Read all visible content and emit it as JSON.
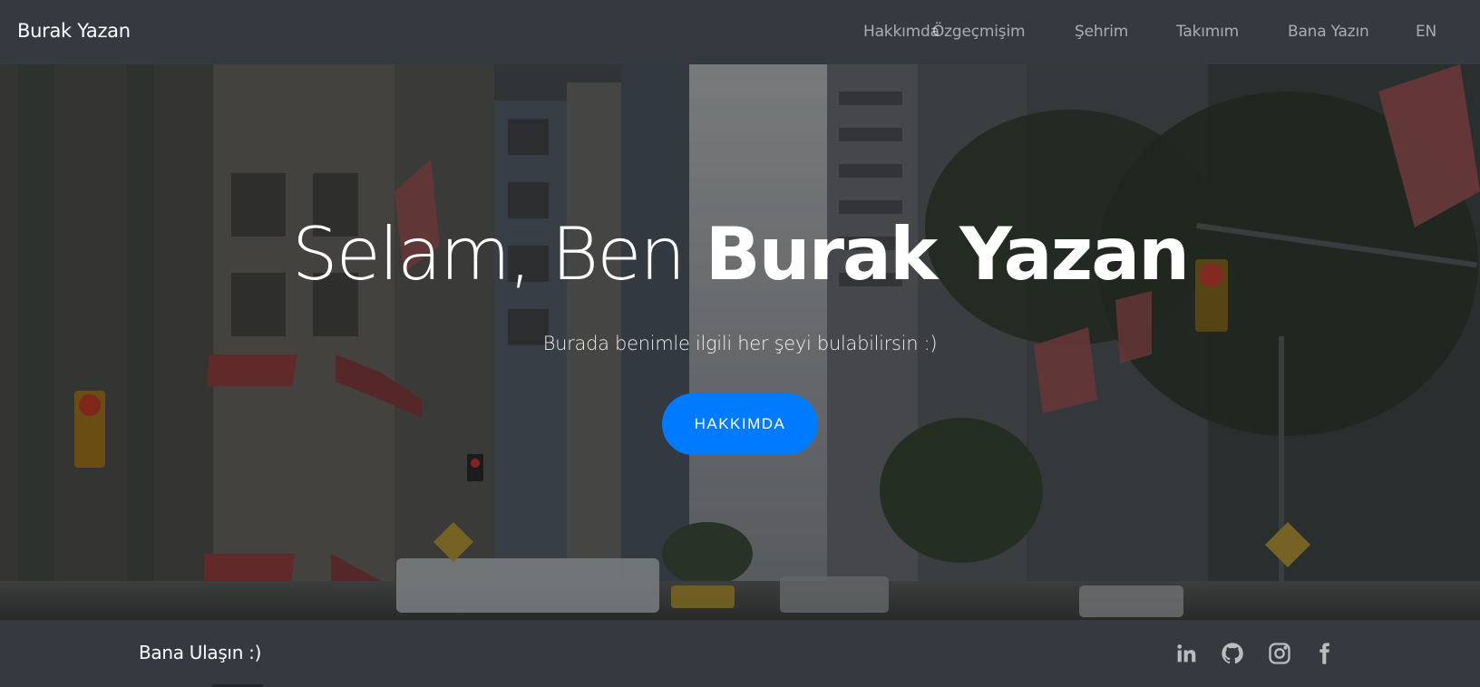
{
  "navbar": {
    "brand": "Burak Yazan",
    "links": [
      {
        "label": "Hakkımda"
      },
      {
        "label": "Özgeçmişim"
      },
      {
        "label": "Şehrim"
      },
      {
        "label": "Takımım"
      },
      {
        "label": "Bana Yazın"
      },
      {
        "label": "EN"
      }
    ]
  },
  "hero": {
    "greeting": "Selam, Ben ",
    "name": "Burak Yazan",
    "subtitle": "Burada benimle ilgili her şeyi bulabilirsin :)",
    "cta_label": "HAKKIMDA",
    "background_icon": "city-street-photo"
  },
  "footer": {
    "contact_text": "Bana Ulaşın :)",
    "social_icons": [
      "linkedin-icon",
      "github-icon",
      "instagram-icon",
      "facebook-icon"
    ]
  },
  "colors": {
    "navbar_bg": "#343a40",
    "accent": "#007bff",
    "nav_link": "rgba(255,255,255,0.58)"
  }
}
